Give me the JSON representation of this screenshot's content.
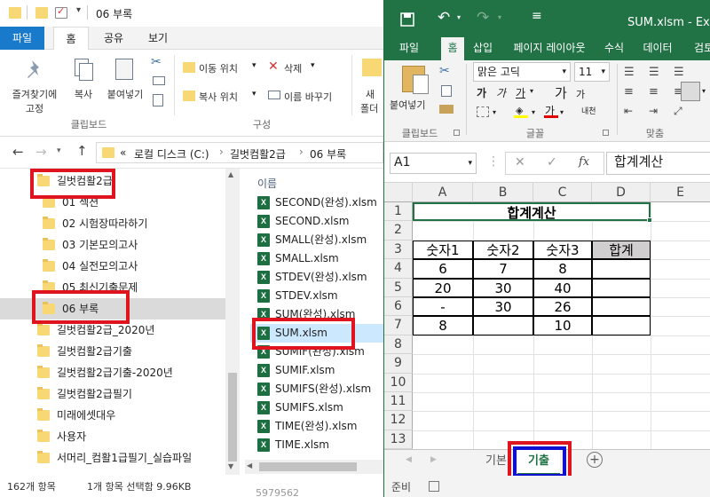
{
  "explorer": {
    "title": "06 부록",
    "tabs": {
      "file": "파일",
      "home": "홈",
      "share": "공유",
      "view": "보기"
    },
    "ribbon": {
      "pin_label_1": "즐겨찾기에",
      "pin_label_2": "고정",
      "copy_label": "복사",
      "paste_label": "붙여넣기",
      "move_to_label": "이동 위치",
      "copy_to_label": "복사 위치",
      "delete_label": "삭제",
      "rename_label": "이름 바꾸기",
      "new_folder_label_1": "새",
      "new_folder_label_2": "폴더",
      "group_clipboard": "클립보드",
      "group_organize": "구성"
    },
    "address": {
      "prefix": "«",
      "parts": [
        "로컬 디스크 (C:)",
        "길벗컴활2급",
        "06 부록"
      ]
    },
    "tree": [
      {
        "label": "길벗컴활2급",
        "indent": 0,
        "selected": false
      },
      {
        "label": "01 섹션",
        "indent": 1,
        "selected": false
      },
      {
        "label": "02 시험장따라하기",
        "indent": 1,
        "selected": false
      },
      {
        "label": "03 기본모의고사",
        "indent": 1,
        "selected": false
      },
      {
        "label": "04 실전모의고사",
        "indent": 1,
        "selected": false
      },
      {
        "label": "05 최신기출문제",
        "indent": 1,
        "selected": false
      },
      {
        "label": "06 부록",
        "indent": 1,
        "selected": true
      },
      {
        "label": "길벗컴활2급_2020년",
        "indent": 0,
        "selected": false
      },
      {
        "label": "길벗컴활2급기출",
        "indent": 0,
        "selected": false
      },
      {
        "label": "길벗컴활2급기출-2020년",
        "indent": 0,
        "selected": false
      },
      {
        "label": "길벗컴활2급필기",
        "indent": 0,
        "selected": false
      },
      {
        "label": "미래에셋대우",
        "indent": 0,
        "selected": false
      },
      {
        "label": "사용자",
        "indent": 0,
        "selected": false
      },
      {
        "label": "서머리_컴활1급필기_실습파일",
        "indent": 0,
        "selected": false
      }
    ],
    "list_header": "이름",
    "files": [
      {
        "label": "SECOND(완성).xlsm",
        "selected": false
      },
      {
        "label": "SECOND.xlsm",
        "selected": false
      },
      {
        "label": "SMALL(완성).xlsm",
        "selected": false
      },
      {
        "label": "SMALL.xlsm",
        "selected": false
      },
      {
        "label": "STDEV(완성).xlsm",
        "selected": false
      },
      {
        "label": "STDEV.xlsm",
        "selected": false
      },
      {
        "label": "SUM(완성).xlsm",
        "selected": false
      },
      {
        "label": "SUM.xlsm",
        "selected": true
      },
      {
        "label": "SUMIF(완성).xlsm",
        "selected": false
      },
      {
        "label": "SUMIF.xlsm",
        "selected": false
      },
      {
        "label": "SUMIFS(완성).xlsm",
        "selected": false
      },
      {
        "label": "SUMIFS.xlsm",
        "selected": false
      },
      {
        "label": "TIME(완성).xlsm",
        "selected": false
      },
      {
        "label": "TIME.xlsm",
        "selected": false
      }
    ],
    "status": {
      "count": "162개 항목",
      "selection": "1개 항목 선택함 9.96KB"
    },
    "behind_text": "5979562"
  },
  "excel": {
    "title": "SUM.xlsm - Excel",
    "tabs": [
      "파일",
      "홈",
      "삽입",
      "페이지 레이아웃",
      "수식",
      "데이터",
      "검토"
    ],
    "ribbon": {
      "paste_label": "붙여넣기",
      "font_name": "맑은 고딕",
      "font_size": "11",
      "bold": "가",
      "italic": "가",
      "underline": "가",
      "font_color_glyph": "가",
      "grow_font": "가",
      "shrink_font": "가",
      "phonetic": "내천",
      "group_clipboard": "클립보드",
      "group_font": "글꼴",
      "group_align": "맞춤"
    },
    "name_box": "A1",
    "formula_value": "합계계산",
    "columns": [
      "A",
      "B",
      "C",
      "D",
      "E"
    ],
    "rows": [
      "1",
      "2",
      "3",
      "4",
      "5",
      "6",
      "7",
      "8",
      "9",
      "10",
      "11",
      "12",
      "13"
    ],
    "sheet": {
      "title": "합계계산",
      "headers": [
        "숫자1",
        "숫자2",
        "숫자3",
        "합계"
      ],
      "data": [
        [
          "6",
          "7",
          "8",
          ""
        ],
        [
          "20",
          "30",
          "40",
          ""
        ],
        [
          "-",
          "30",
          "26",
          ""
        ],
        [
          "8",
          "",
          "10",
          ""
        ]
      ]
    },
    "sheet_tabs": [
      "기본",
      "기출"
    ],
    "active_sheet": "기출",
    "status_ready": "준비"
  },
  "colors": {
    "excel_green": "#217346",
    "explorer_blue": "#1979ca",
    "highlight_red": "#e0141e",
    "highlight_blue": "#1010d0"
  }
}
